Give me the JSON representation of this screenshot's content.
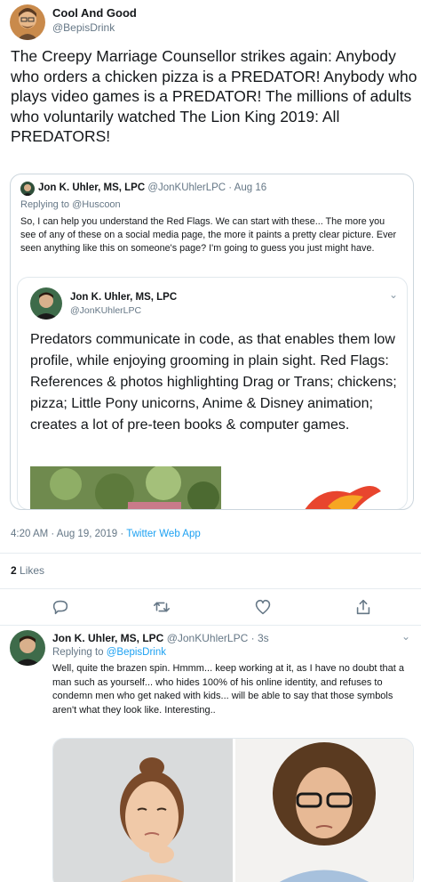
{
  "main_tweet": {
    "author_name": "Cool And Good",
    "author_handle": "@BepisDrink",
    "text": "The Creepy Marriage Counsellor strikes again: Anybody who orders a chicken pizza is a PREDATOR! Anybody who plays video games is a PREDATOR! The millions of adults who voluntarily watched The Lion King 2019: All PREDATORS!",
    "timestamp": "4:20 AM · Aug 19, 2019 · ",
    "source": "Twitter Web App",
    "likes_count": "2",
    "likes_label": " Likes"
  },
  "quoted_tweet": {
    "author_name": "Jon K. Uhler, MS, LPC",
    "author_handle": "@JonKUhlerLPC",
    "date": "· Aug 16",
    "replying_to": "Replying to @Huscoon",
    "text": "So, I can help you understand the Red Flags. We can start with these... The more you see of any of these on a social media page, the more it paints a pretty clear picture. Ever seen anything like this on someone's page? I'm going to guess you just might have."
  },
  "inner_quoted_tweet": {
    "author_name": "Jon K. Uhler, MS, LPC",
    "author_handle": "@JonKUhlerLPC",
    "text": "Predators communicate in code, as that enables them low profile, while enjoying grooming in plain sight. Red Flags: References & photos highlighting Drag or Trans; chickens; pizza; Little Pony unicorns, Anime & Disney animation; creates a lot of pre-teen books & computer games."
  },
  "reply_tweet": {
    "author_name": "Jon K. Uhler, MS, LPC",
    "author_handle": "@JonKUhlerLPC",
    "time": "· 3s",
    "replying_prefix": "Replying to ",
    "replying_handle": "@BepisDrink",
    "text": "Well, quite the brazen spin. Hmmm... keep working at it, as I have no doubt that a man such as yourself... who hides 100% of his online identity, and refuses to condemn men who get naked with kids... will be able to say that those symbols aren't what they look like. Interesting.."
  },
  "icons": {
    "reply": "reply-icon",
    "retweet": "retweet-icon",
    "like": "heart-icon",
    "share": "share-icon",
    "chevron": "chevron-down-icon"
  },
  "colors": {
    "link": "#1da1f2",
    "secondary_text": "#657786",
    "border": "#e1e8ed"
  }
}
